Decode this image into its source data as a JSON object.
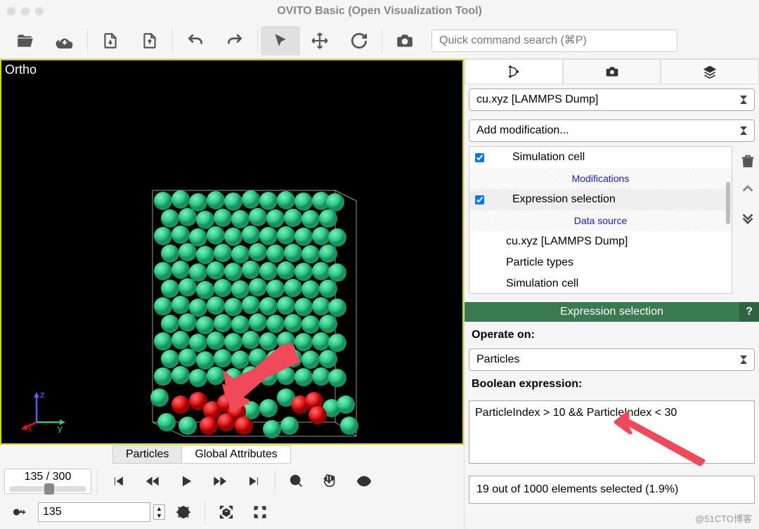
{
  "app": {
    "title": "OVITO Basic (Open Visualization Tool)"
  },
  "search": {
    "placeholder": "Quick command search (⌘P)"
  },
  "viewport": {
    "mode": "Ortho",
    "axes": {
      "x": "x",
      "y": "y",
      "z": "z"
    }
  },
  "tabs": {
    "particles": "Particles",
    "global": "Global Attributes"
  },
  "timeline": {
    "current": 135,
    "total": 300,
    "label": "135 / 300",
    "input": "135"
  },
  "pipeline": {
    "source_dropdown": "cu.xyz [LAMMPS Dump]",
    "add_mod": "Add modification...",
    "items": [
      {
        "check": true,
        "label": "Simulation cell"
      },
      {
        "header": true,
        "label": "Modifications"
      },
      {
        "check": true,
        "label": "Expression selection",
        "selected": true
      },
      {
        "header": true,
        "label": "Data source"
      },
      {
        "label": "cu.xyz [LAMMPS Dump]"
      },
      {
        "nested": true,
        "label": "Particle types"
      },
      {
        "nested": true,
        "label": "Simulation cell"
      }
    ]
  },
  "panel": {
    "title": "Expression selection",
    "operate_on_lbl": "Operate on:",
    "operate_on": "Particles",
    "bool_lbl": "Boolean expression:",
    "expression": "ParticleIndex > 10 && ParticleIndex < 30",
    "status": "19 out of 1000 elements selected (1.9%)"
  },
  "watermark": "@51CTO博客"
}
